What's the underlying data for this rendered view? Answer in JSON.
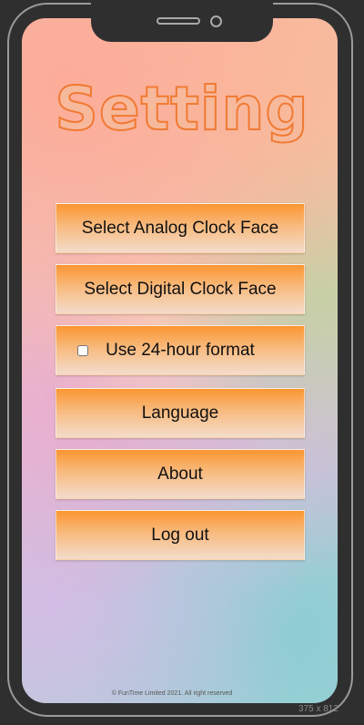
{
  "title": "Setting",
  "buttons": {
    "analog": "Select Analog Clock Face",
    "digital": "Select Digital Clock Face",
    "format24": "Use 24-hour format",
    "language": "Language",
    "about": "About",
    "logout": "Log out"
  },
  "format24_checked": false,
  "footer": "© FunTime Limited 2021. All right reserved",
  "frame_size_label": "375 x 812",
  "colors": {
    "button_top": "#fb9631",
    "button_bottom": "#f3dccc",
    "title_fill": "#f7b99c",
    "title_stroke": "#f07a33"
  }
}
